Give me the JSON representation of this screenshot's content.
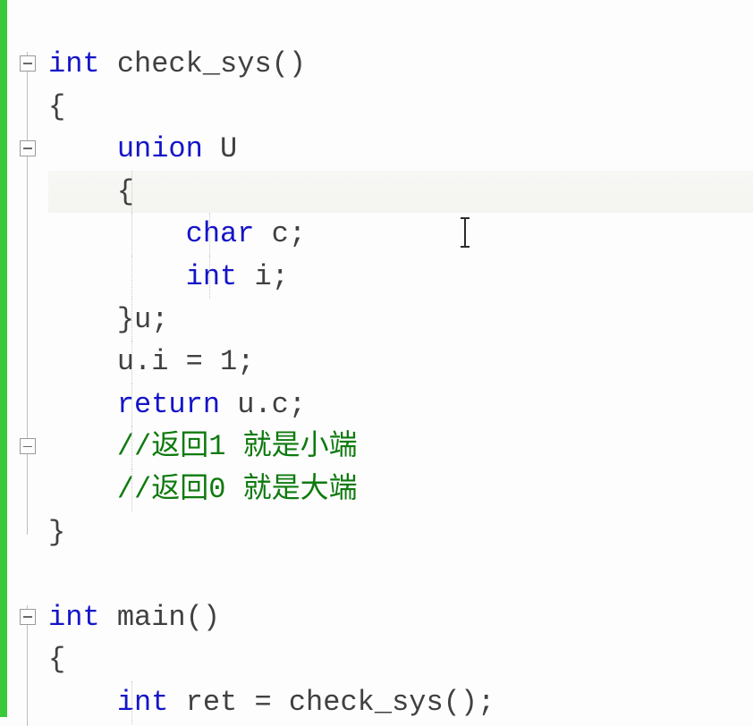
{
  "code": {
    "lines": [
      {
        "indent": 0,
        "tokens": [
          [
            "typ",
            "int"
          ],
          [
            "pln",
            " "
          ],
          [
            "fun",
            "check_sys"
          ],
          [
            "pln",
            "()"
          ]
        ],
        "fold": true
      },
      {
        "indent": 0,
        "tokens": [
          [
            "pln",
            "{"
          ]
        ]
      },
      {
        "indent": 1,
        "tokens": [
          [
            "kw",
            "union"
          ],
          [
            "pln",
            " "
          ],
          [
            "id",
            "U"
          ]
        ],
        "fold": true,
        "highlight_after": true
      },
      {
        "indent": 1,
        "tokens": [
          [
            "pln",
            "{"
          ]
        ],
        "highlight": true,
        "guides": [
          1
        ]
      },
      {
        "indent": 2,
        "tokens": [
          [
            "typ",
            "char"
          ],
          [
            "pln",
            " "
          ],
          [
            "id",
            "c"
          ],
          [
            "pln",
            ";"
          ]
        ],
        "caret": true,
        "guides": [
          1,
          2
        ]
      },
      {
        "indent": 2,
        "tokens": [
          [
            "typ",
            "int"
          ],
          [
            "pln",
            " "
          ],
          [
            "id",
            "i"
          ],
          [
            "pln",
            ";"
          ]
        ],
        "guides": [
          1,
          2
        ]
      },
      {
        "indent": 1,
        "tokens": [
          [
            "pln",
            "}"
          ],
          [
            "id",
            "u"
          ],
          [
            "pln",
            ";"
          ]
        ],
        "guides": [
          1
        ]
      },
      {
        "indent": 1,
        "tokens": [
          [
            "id",
            "u.i"
          ],
          [
            "pln",
            " = "
          ],
          [
            "num",
            "1"
          ],
          [
            "pln",
            ";"
          ]
        ],
        "guides": [
          1
        ]
      },
      {
        "indent": 1,
        "tokens": [
          [
            "kw",
            "return"
          ],
          [
            "pln",
            " "
          ],
          [
            "id",
            "u.c"
          ],
          [
            "pln",
            ";"
          ]
        ],
        "guides": [
          1
        ]
      },
      {
        "indent": 1,
        "tokens": [
          [
            "cmt",
            "//返回1 就是小端"
          ]
        ],
        "fold": true,
        "guides": [
          1
        ]
      },
      {
        "indent": 1,
        "tokens": [
          [
            "cmt",
            "//返回0 就是大端"
          ]
        ],
        "guides": [
          1
        ]
      },
      {
        "indent": 0,
        "tokens": [
          [
            "pln",
            "}"
          ]
        ]
      },
      {
        "blank": true
      },
      {
        "indent": 0,
        "tokens": [
          [
            "typ",
            "int"
          ],
          [
            "pln",
            " "
          ],
          [
            "fun",
            "main"
          ],
          [
            "pln",
            "()"
          ]
        ],
        "fold": true
      },
      {
        "indent": 0,
        "tokens": [
          [
            "pln",
            "{"
          ]
        ]
      },
      {
        "indent": 1,
        "tokens": [
          [
            "typ",
            "int"
          ],
          [
            "pln",
            " "
          ],
          [
            "id",
            "ret"
          ],
          [
            "pln",
            " = "
          ],
          [
            "fun",
            "check_sys"
          ],
          [
            "pln",
            "();"
          ]
        ],
        "guides": [
          1
        ]
      }
    ]
  },
  "indent_unit": "    ",
  "caret_offset_spaces": 9
}
